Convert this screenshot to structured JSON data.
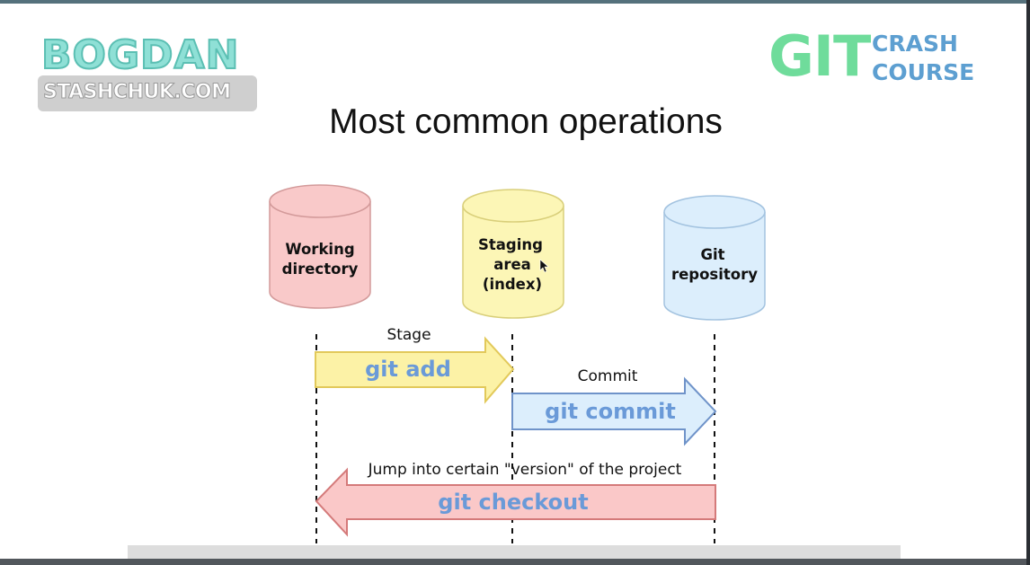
{
  "branding": {
    "logo_name": "BOGDAN",
    "logo_site": "STASHCHUK.COM",
    "course_big": "GIT",
    "course_line1": "CRASH",
    "course_line2": "COURSE"
  },
  "slide": {
    "title": "Most common operations"
  },
  "areas": [
    {
      "lines": [
        "Working",
        "directory"
      ],
      "color": "#f9c9c9"
    },
    {
      "lines": [
        "Staging",
        "area",
        "(index)"
      ],
      "color": "#fcf6b6"
    },
    {
      "lines": [
        "Git",
        "repository"
      ],
      "color": "#dceefc"
    }
  ],
  "operations": [
    {
      "label": "Stage",
      "command": "git add",
      "color": "#fcf2a6"
    },
    {
      "label": "Commit",
      "command": "git commit",
      "color": "#dceefc"
    },
    {
      "label": "Jump into certain \"version\" of the project",
      "command": "git checkout",
      "color": "#fac8c8"
    }
  ]
}
